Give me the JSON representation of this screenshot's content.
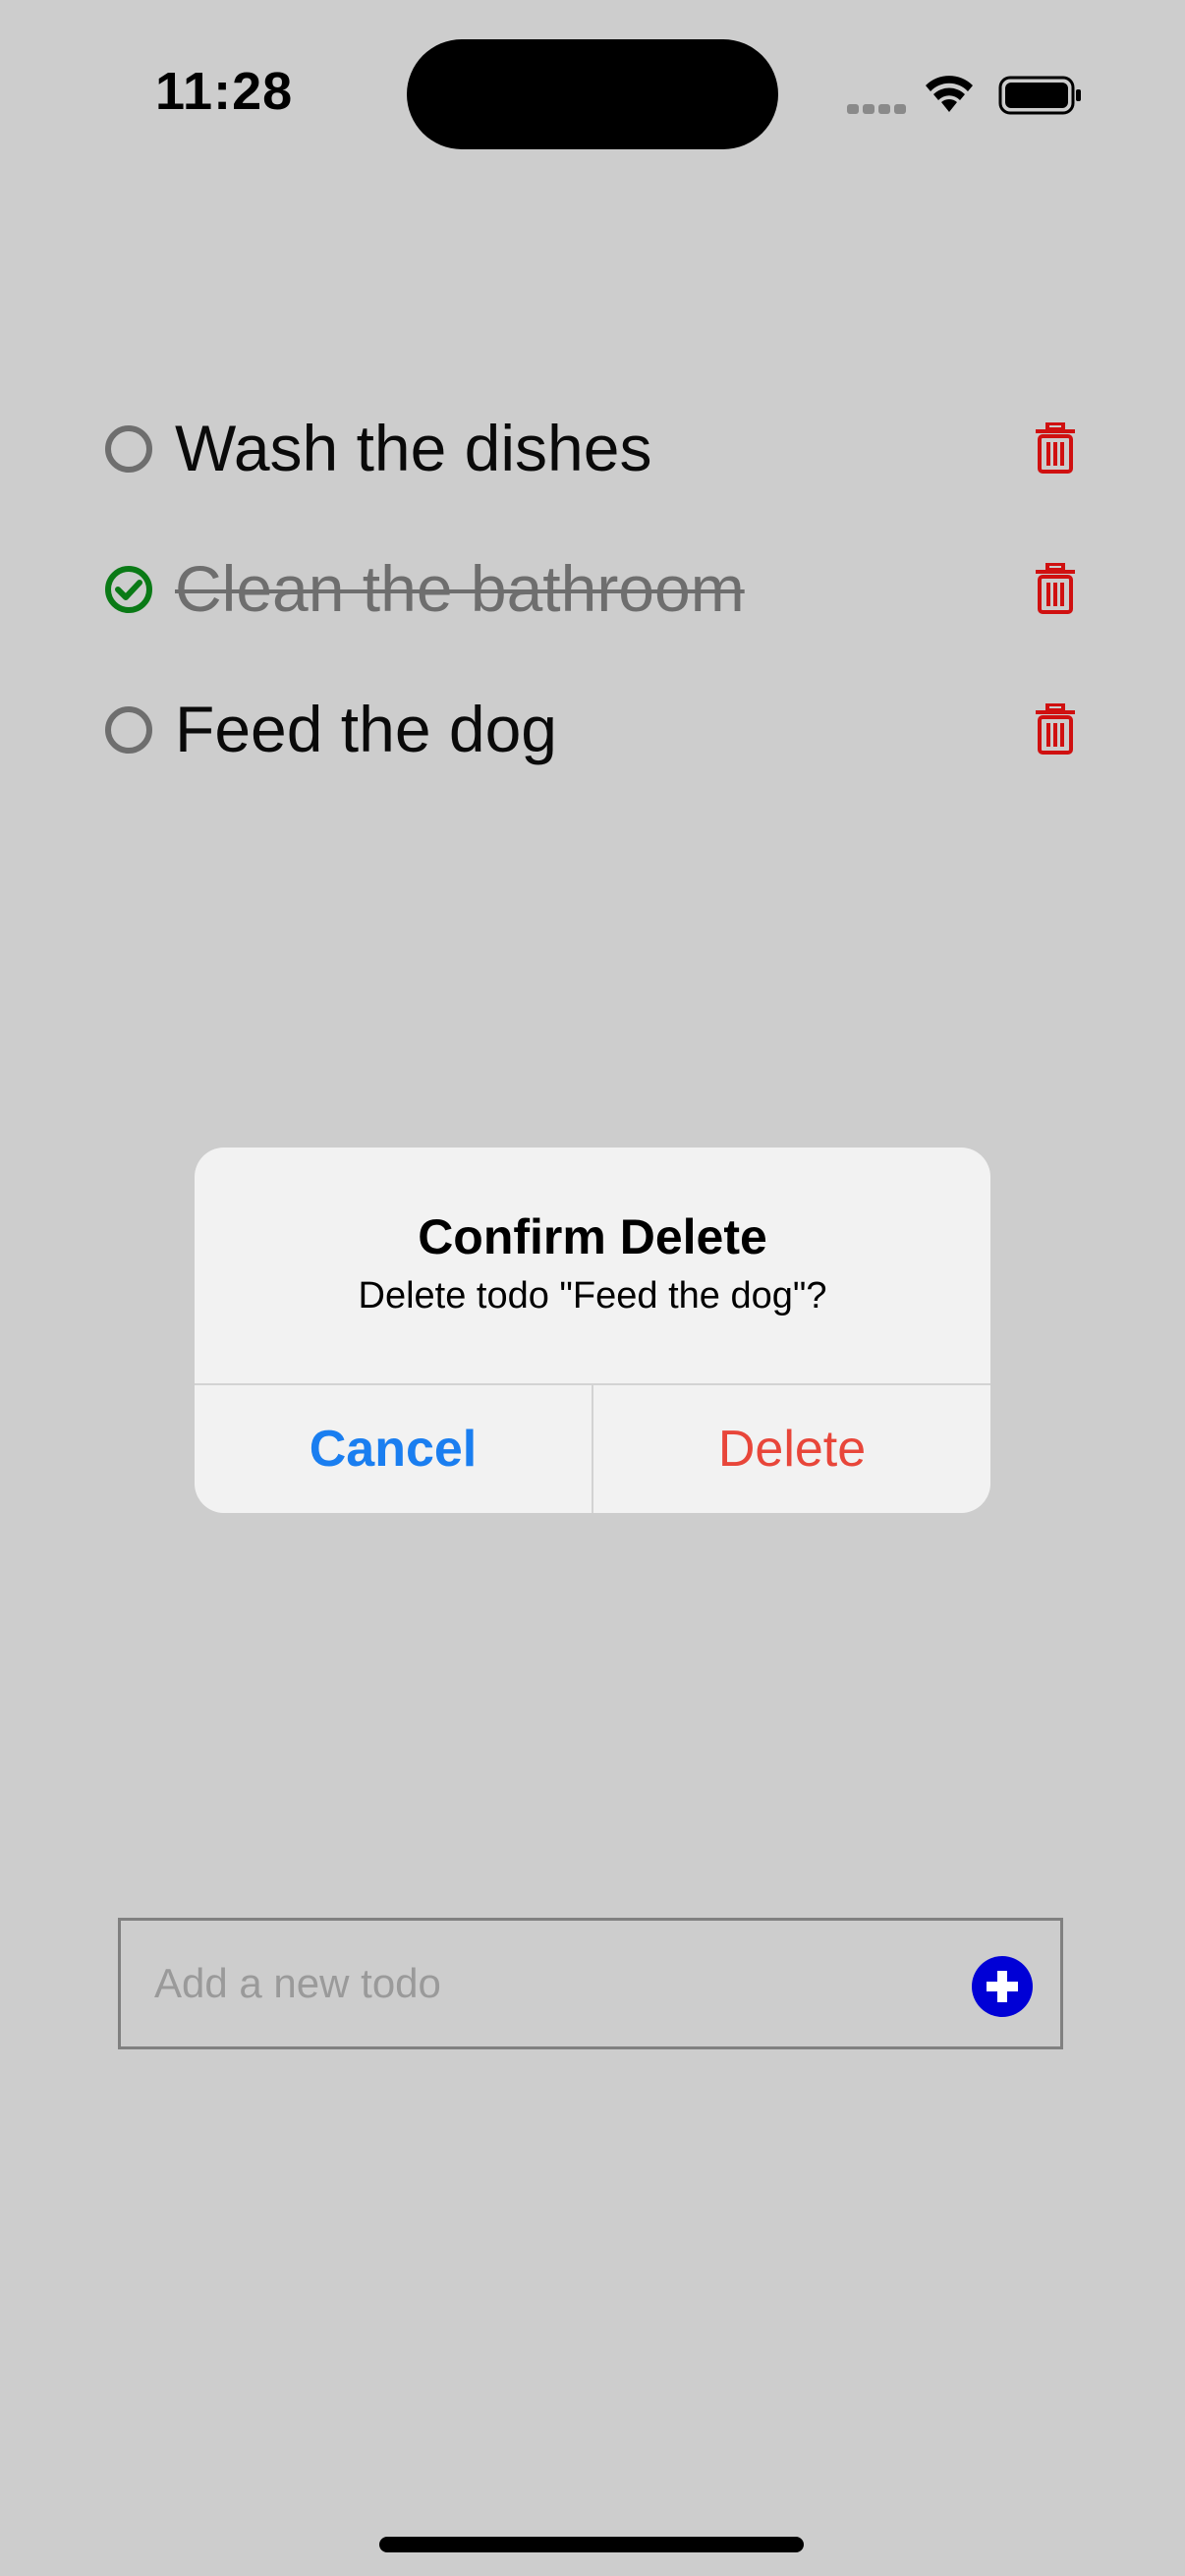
{
  "status_bar": {
    "time": "11:28"
  },
  "todos": [
    {
      "label": "Wash the dishes",
      "completed": false
    },
    {
      "label": "Clean the bathroom",
      "completed": true
    },
    {
      "label": "Feed the dog",
      "completed": false
    }
  ],
  "dialog": {
    "title": "Confirm Delete",
    "message": "Delete todo \"Feed the dog\"?",
    "cancel_label": "Cancel",
    "delete_label": "Delete"
  },
  "add_todo": {
    "placeholder": "Add a new todo"
  },
  "colors": {
    "background": "#cdcdcd",
    "check_done": "#0a7a16",
    "check_open": "#6e6e6e",
    "trash": "#d01010",
    "accent_blue": "#1a7ef0",
    "destructive": "#e8463a",
    "add_button": "#0000d6"
  },
  "icons": {
    "trash": "trash-icon",
    "check_done": "check-circle-icon",
    "check_open": "circle-icon",
    "add": "plus-circle-icon"
  }
}
